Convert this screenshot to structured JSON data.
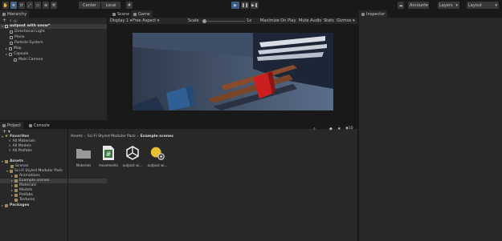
{
  "toolbar": {
    "center_label": "Center",
    "local_label": "Local",
    "account_label": "Account",
    "layers_label": "Layers",
    "layout_label": "Layout"
  },
  "hierarchy": {
    "tab_label": "Hierarchy",
    "search_placeholder": "All",
    "scene_name": "outpost with snow*",
    "items": [
      {
        "label": "Directional Light"
      },
      {
        "label": "Plane"
      },
      {
        "label": "Particle System"
      },
      {
        "label": "Map"
      },
      {
        "label": "Capsule"
      },
      {
        "label": "Main Camera"
      }
    ]
  },
  "scene_view": {
    "scene_tab": "Scene",
    "game_tab": "Game",
    "display": "Display 1",
    "aspect": "Free Aspect",
    "scale_label": "Scale",
    "scale_value": "1x",
    "maximize": "Maximize On Play",
    "mute": "Mute Audio",
    "stats": "Stats",
    "gizmos": "Gizmos"
  },
  "inspector": {
    "tab_label": "Inspector"
  },
  "project": {
    "project_tab": "Project",
    "console_tab": "Console",
    "hidden_count": "10",
    "favorites_label": "Favorites",
    "favorites": [
      "All Materials",
      "All Models",
      "All Prefabs"
    ],
    "assets_label": "Assets",
    "tree": [
      {
        "label": "Scenes",
        "depth": 1
      },
      {
        "label": "Sci-Fi Styled Modular Pack",
        "depth": 1
      },
      {
        "label": "Animations",
        "depth": 2
      },
      {
        "label": "Example scenes",
        "depth": 2
      },
      {
        "label": "Materials",
        "depth": 2
      },
      {
        "label": "Models",
        "depth": 2
      },
      {
        "label": "Prefabs",
        "depth": 2
      },
      {
        "label": "Textures",
        "depth": 2
      }
    ],
    "packages_label": "Packages",
    "breadcrumb": [
      "Assets",
      "Sci-Fi Styled Modular Pack",
      "Example scenes"
    ],
    "assets": [
      {
        "label": "Materials",
        "icon": "folder-icon"
      },
      {
        "label": "movements",
        "icon": "csharp-script-icon"
      },
      {
        "label": "outpost wi...",
        "icon": "unity-scene-icon"
      },
      {
        "label": "outpost wi...",
        "icon": "lighting-settings-icon"
      }
    ]
  }
}
